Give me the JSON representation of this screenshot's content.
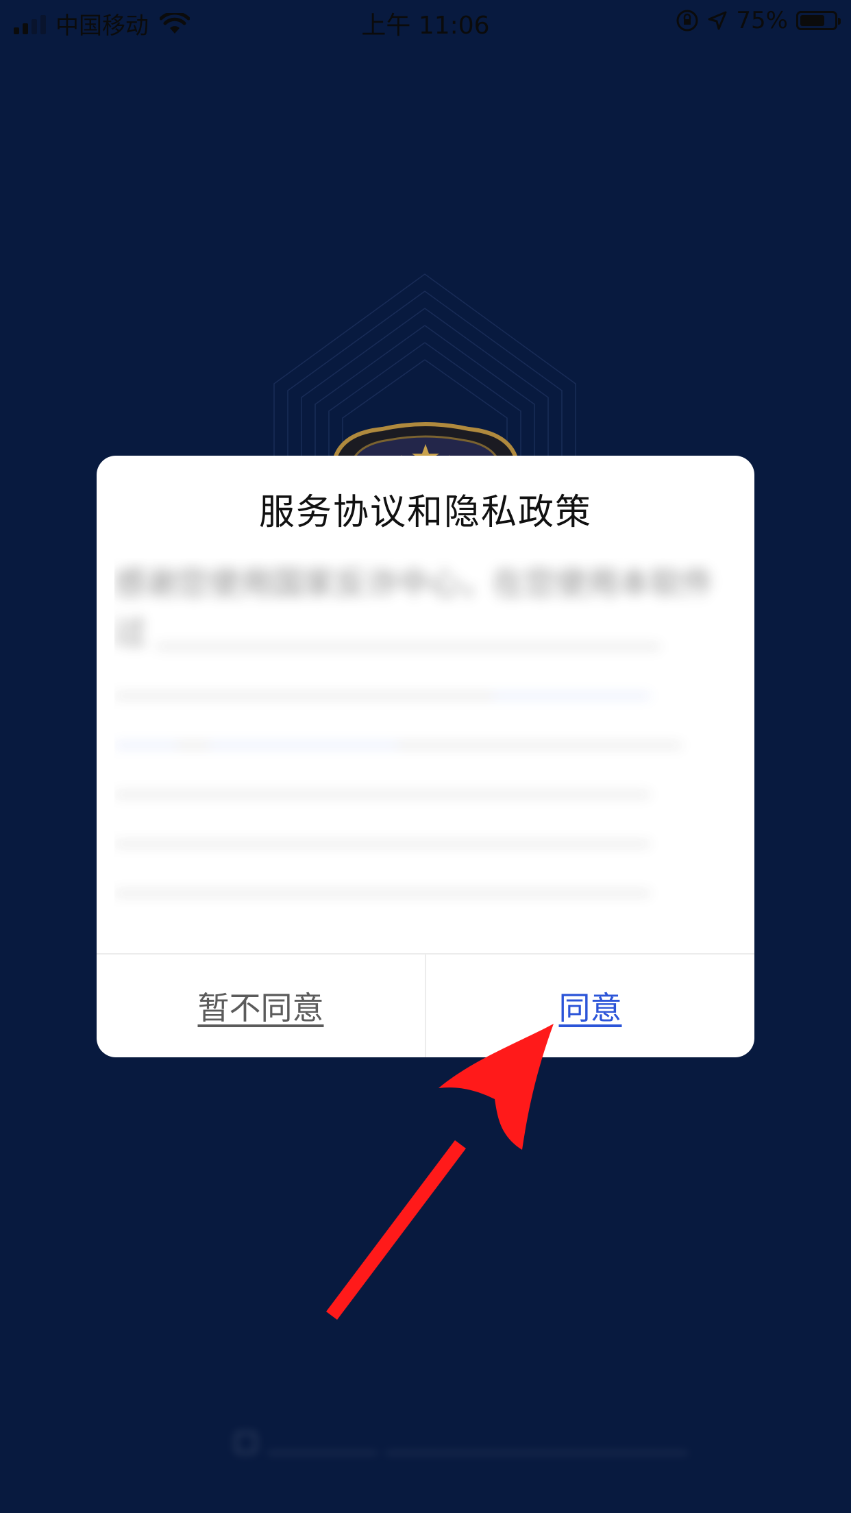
{
  "status_bar": {
    "carrier": "中国移动",
    "time": "上午 11:06",
    "battery": "75%",
    "battery_level": 0.75
  },
  "dialog": {
    "title": "服务协议和隐私政策",
    "body_text": "感谢您使用国家反诈中心，在您使用本软件过",
    "decline_label": "暂不同意",
    "agree_label": "同意"
  },
  "colors": {
    "background": "#081a3f",
    "agree_link": "#2b54d8",
    "decline_link": "#5b5b5b",
    "annotation_arrow": "#ff1a1a"
  },
  "icons": {
    "signal": "signal-bars-icon",
    "wifi": "wifi-icon",
    "rotation_lock": "rotation-lock-icon",
    "location": "location-arrow-icon",
    "battery": "battery-icon",
    "emblem": "police-badge-emblem",
    "annotation": "red-arrow-annotation"
  }
}
